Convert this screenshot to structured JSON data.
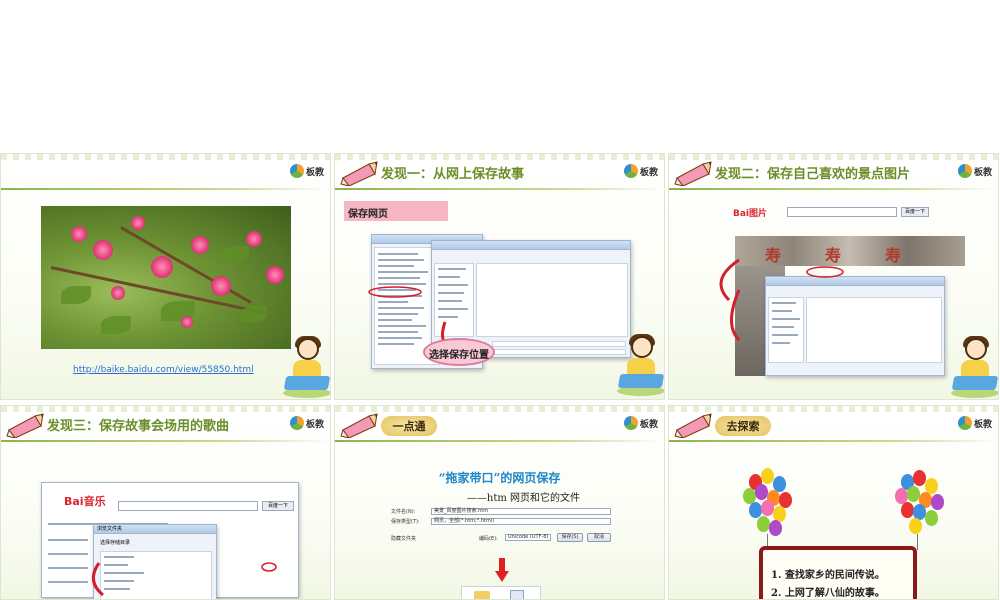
{
  "colors": {
    "title_green": "#6b8d2a",
    "link_blue": "#2a6fd1",
    "accent_pink": "#f7b6c4",
    "subtitle_blue": "#1e86c9",
    "board_red": "#8a1a1a"
  },
  "logo": {
    "text": "板教"
  },
  "slides": {
    "s1": {
      "link": "http://baike.baidu.com/view/55850.html"
    },
    "s2": {
      "title": "发现一：从网上保存故事",
      "label": "保存网页",
      "bubble": "选择保存位置"
    },
    "s3": {
      "title": "发现二：保存自己喜欢的景点图片",
      "site_text": "Bai图片",
      "search_btn": "百度一下"
    },
    "s4": {
      "title": "发现三：保存故事会场用的歌曲",
      "site_text": "Bai音乐",
      "search_btn": "百度一下",
      "dialog_title": "浏览文件夹",
      "dialog_label": "选择存储目录"
    },
    "s5": {
      "tag": "一点通",
      "title": "“拖家带口”的网页保存",
      "subtitle": "——htm 网页和它的文件",
      "form": {
        "filename_label": "文件名(N):",
        "filename_value": "美景_百度图片搜索.htm",
        "type_label": "保存类型(T):",
        "type_value": "网页，全部(*.htm;*.html)",
        "encoding_label": "编码(E):",
        "encoding_value": "Unicode (UTF-8)",
        "hide_folders": "隐藏文件夹",
        "save_btn": "保存(S)",
        "cancel_btn": "取消"
      }
    },
    "s6": {
      "tag": "去探索",
      "items": [
        "1. 查找家乡的民间传说。",
        "2. 上网了解八仙的故事。"
      ]
    }
  }
}
